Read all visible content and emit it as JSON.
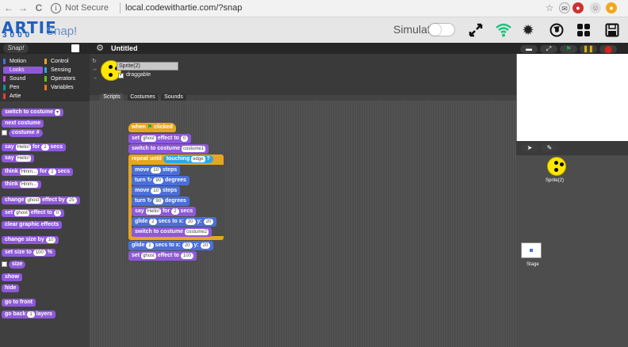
{
  "browser": {
    "back": "←",
    "forward": "→",
    "reload": "C",
    "info": "i",
    "not_secure": "Not Secure",
    "url": "local.codewithartie.com/?snap",
    "icons": [
      "star-icon",
      "mail-icon",
      "extension-icon",
      "profile-icon",
      "notification-icon"
    ]
  },
  "header": {
    "logo_artie": "ARTIE",
    "logo_3000": "3000",
    "logo_snap": "Snap!",
    "simulate": "Simulate",
    "icons": [
      "fullscreen-icon",
      "wifi-icon",
      "settings-icon",
      "globe-icon",
      "apps-icon",
      "save-icon"
    ],
    "colors": {
      "wifi": "#19c37d",
      "brand": "#1f5fbf"
    }
  },
  "snap_bar": {
    "logo": "Snap!",
    "project_title": "Untitled",
    "run_colors": {
      "go": "#19a84a",
      "pause": "#e0b500",
      "stop": "#d9211d"
    }
  },
  "categories": [
    {
      "label": "Motion",
      "color": "#4a6fd8"
    },
    {
      "label": "Control",
      "color": "#e7a524"
    },
    {
      "label": "Looks",
      "color": "#8e59d9"
    },
    {
      "label": "Sensing",
      "color": "#2fa6e0"
    },
    {
      "label": "Sound",
      "color": "#cf4ad9"
    },
    {
      "label": "Operators",
      "color": "#62c213"
    },
    {
      "label": "Pen",
      "color": "#009e8e"
    },
    {
      "label": "Variables",
      "color": "#f3761d"
    },
    {
      "label": "Artie",
      "color": "#e33f3f"
    }
  ],
  "palette": {
    "switch_costume": "switch to costume",
    "next_costume": "next costume",
    "costume_num": "costume #",
    "say_for_1": "say",
    "say_for_hello": "Hello!",
    "say_for_2": "for",
    "say_for_n": "2",
    "say_for_3": "secs",
    "say": "say",
    "say_hello": "Hello!",
    "think_for_1": "think",
    "think_hmm": "Hmm...",
    "think_for_2": "for",
    "think_for_n": "2",
    "think_for_3": "secs",
    "think": "think",
    "think_hmm2": "Hmm...",
    "change_effect_1": "change",
    "change_effect_ghost": "ghost",
    "change_effect_2": "effect by",
    "change_effect_n": "25",
    "set_effect_1": "set",
    "set_effect_ghost": "ghost",
    "set_effect_2": "effect to",
    "set_effect_n": "0",
    "clear_effects": "clear graphic effects",
    "change_size": "change size by",
    "change_size_n": "10",
    "set_size": "set size to",
    "set_size_n": "100",
    "set_size_pct": "%",
    "size": "size",
    "show": "show",
    "hide": "hide",
    "go_front": "go to front",
    "go_back_1": "go back",
    "go_back_n": "1",
    "go_back_2": "layers"
  },
  "sprite": {
    "name": "Sprite(2)",
    "draggable": "draggable",
    "tabs": [
      "Scripts",
      "Costumes",
      "Sounds"
    ]
  },
  "script": {
    "when_clicked_1": "when",
    "when_clicked_2": "clicked",
    "set_ghost_1": "set",
    "set_ghost_effect": "ghost",
    "set_ghost_2": "effect to",
    "set_ghost_n": "0",
    "switch_1": "switch to costume",
    "switch_1_val": "costume1",
    "repeat_until": "repeat until",
    "touching": "touching",
    "touching_val": "edge",
    "touching_q": "?",
    "move1": "move",
    "move1_n": "10",
    "move1_2": "steps",
    "turn1": "turn",
    "turn1_n": "90",
    "turn1_2": "degrees",
    "move2": "move",
    "move2_n": "10",
    "move2_2": "steps",
    "turn2": "turn",
    "turn2_n": "90",
    "turn2_2": "degrees",
    "say_1": "say",
    "say_hello": "Hello!",
    "say_2": "for",
    "say_n": "2",
    "say_3": "secs",
    "glide1_1": "glide",
    "glide1_n": "2",
    "glide1_2": "secs to x:",
    "glide1_x": "20",
    "glide1_3": "y:",
    "glide1_y": "20",
    "switch_2": "switch to costume",
    "switch_2_val": "costume2",
    "glide2_1": "glide",
    "glide2_n": "2",
    "glide2_2": "secs to x:",
    "glide2_x": "20",
    "glide2_3": "y:",
    "glide2_y": "20",
    "set2_1": "set",
    "set2_effect": "ghost",
    "set2_2": "effect to",
    "set2_n": "100"
  },
  "corral": {
    "sprite_label": "Sprite(2)",
    "stage_label": "Stage"
  }
}
